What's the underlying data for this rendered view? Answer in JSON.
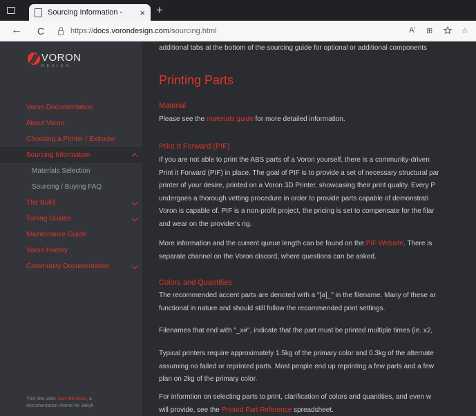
{
  "browser": {
    "tab_title": "Sourcing Information -",
    "tab_close": "×",
    "new_tab": "+",
    "back": "←",
    "reload": "C",
    "url_prefix": "https://",
    "url_host": "docs.vorondesign.com",
    "url_path": "/sourcing.html",
    "read_aloud": "Aʹ",
    "ext_icon": "⊞",
    "favorite": "☆"
  },
  "sidebar": {
    "logo_word": "VORON",
    "logo_sub": "DESIGN",
    "items": [
      {
        "label": "Voron Documentation"
      },
      {
        "label": "About Voron"
      },
      {
        "label": "Choosing a Printer / Extruder"
      },
      {
        "label": "Sourcing Information"
      },
      {
        "label": "Materials Selection"
      },
      {
        "label": "Sourcing / Buying FAQ"
      },
      {
        "label": "The Build"
      },
      {
        "label": "Tuning Guides"
      },
      {
        "label": "Maintenance Guide"
      },
      {
        "label": "Voron History"
      },
      {
        "label": "Community Documentation"
      }
    ],
    "footer_pre": "This site uses ",
    "footer_link": "Just the Docs",
    "footer_post": ", a",
    "footer_line2": "documentation theme for Jekyll."
  },
  "main": {
    "top_line": "additional tabs at the bottom of the sourcing guide for optional or additional components",
    "h1": "Printing Parts",
    "material": {
      "heading": "Material",
      "pre": "Please see the ",
      "link": "materials guide",
      "post": " for more detailed information."
    },
    "pif": {
      "heading": "Print It Forward (PIF)",
      "lines": [
        "If you are not able to print the ABS parts of a Voron yourself, there is a community-driven",
        "Print it Forward (PIF) in place. The goal of PIF is to provide a set of necessary structural par",
        "printer of your desire, printed on a Voron 3D Printer, showcasing their print quality. Every P",
        "undergoes a thorough vetting procedure in order to provide parts capable of demonstrati",
        "Voron is capable of. PIF is a non-profit project, the pricing is set to compensate for the filar",
        "and wear on the provider's rig."
      ],
      "more_pre": "More information and the current queue length can be found on the ",
      "more_link": "PIF Website",
      "more_post": ". There is",
      "more_line2": "separate channel on the Voron discord, where questions can be asked."
    },
    "colors": {
      "heading": "Colors and Quantities",
      "p1_line1": "The recommended accent parts are denoted with a \"[a]_\" in the filename. Many of these ar",
      "p1_line2": "functional in nature and should still follow the recommended print settings.",
      "p2": "Filenames that end with \"_x#\", indicate that the part must be printed multiple times (ie. x2,",
      "p3_lines": [
        "Typical printers require approximately 1.5kg of the primary color and 0.3kg of the alternate",
        "assuming no failed or reprinted parts. Most people end up reprinting a few parts and a few",
        "plan on 2kg of the primary color."
      ],
      "p4_line1": "For informtion on selecting parts to print, clarification of colors and quantities, and even w",
      "p4_pre": "will provide, see the ",
      "p4_link": "Printed Part Reference",
      "p4_post": " spreadsheet."
    }
  }
}
